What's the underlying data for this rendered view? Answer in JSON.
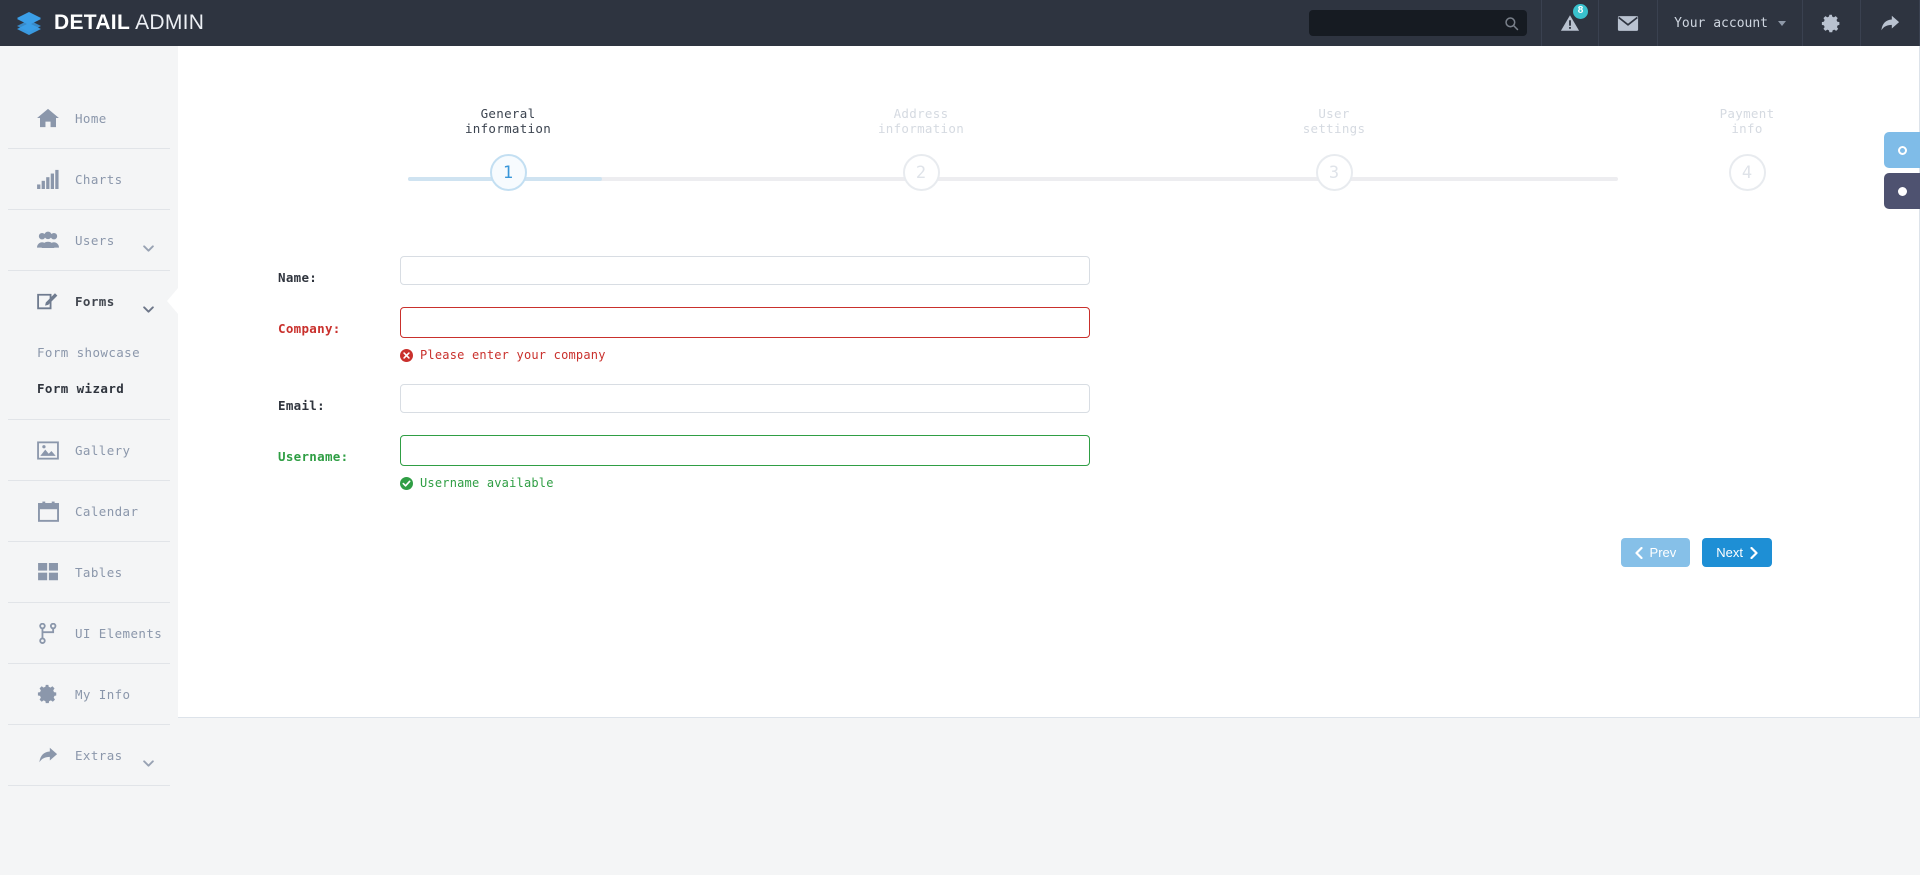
{
  "header": {
    "logo_icon": "layers-icon",
    "brand_bold": "DETAIL",
    "brand_light": "ADMIN",
    "search": {
      "value": "",
      "placeholder": "",
      "icon": "search-icon"
    },
    "alerts": {
      "icon": "warning-triangle-icon",
      "badge": "8"
    },
    "messages": {
      "icon": "envelope-icon"
    },
    "account": {
      "label": "Your account",
      "icon": "chevron-down-icon"
    },
    "settings": {
      "icon": "gear-icon"
    },
    "logout": {
      "icon": "forward-arrow-icon"
    }
  },
  "sidebar": {
    "items": [
      {
        "label": "Home",
        "icon": "home-icon",
        "caret": false,
        "active": false
      },
      {
        "label": "Charts",
        "icon": "bars-icon",
        "caret": false,
        "active": false
      },
      {
        "label": "Users",
        "icon": "users-icon",
        "caret": true,
        "active": false
      },
      {
        "label": "Forms",
        "icon": "pencil-square-icon",
        "caret": true,
        "active": true
      },
      {
        "label": "Gallery",
        "icon": "image-icon",
        "caret": false,
        "active": false
      },
      {
        "label": "Calendar",
        "icon": "calendar-icon",
        "caret": false,
        "active": false
      },
      {
        "label": "Tables",
        "icon": "grid-icon",
        "caret": false,
        "active": false
      },
      {
        "label": "UI Elements",
        "icon": "sitemap-icon",
        "caret": true,
        "active": false
      },
      {
        "label": "My Info",
        "icon": "gear-icon",
        "caret": false,
        "active": false
      },
      {
        "label": "Extras",
        "icon": "forward-arrow-icon",
        "caret": true,
        "active": false
      }
    ],
    "submenu": [
      {
        "label": "Form showcase",
        "active": false
      },
      {
        "label": "Form wizard",
        "active": true
      }
    ]
  },
  "wizard": {
    "steps": [
      {
        "number": "1",
        "title": "General\ninformation",
        "active": true
      },
      {
        "number": "2",
        "title": "Address\ninformation",
        "active": false
      },
      {
        "number": "3",
        "title": "User\nsettings",
        "active": false
      },
      {
        "number": "4",
        "title": "Payment\ninfo",
        "active": false
      }
    ],
    "progress_percent": 16
  },
  "form": {
    "fields": [
      {
        "label": "Name:",
        "value": "",
        "placeholder": "",
        "state": "normal",
        "message": "",
        "message_icon": ""
      },
      {
        "label": "Company:",
        "value": "",
        "placeholder": "",
        "state": "error",
        "message": "Please enter your company",
        "message_icon": "error-circle-icon"
      },
      {
        "label": "Email:",
        "value": "",
        "placeholder": "",
        "state": "normal",
        "message": "",
        "message_icon": ""
      },
      {
        "label": "Username:",
        "value": "",
        "placeholder": "",
        "state": "ok",
        "message": "Username available",
        "message_icon": "check-circle-icon"
      }
    ],
    "buttons": {
      "prev": {
        "label": "Prev",
        "icon": "chevron-left-icon"
      },
      "next": {
        "label": "Next",
        "icon": "chevron-right-icon"
      }
    }
  },
  "float_toggles": [
    {
      "icon": "circle-outline-icon",
      "color": "#7fbce8"
    },
    {
      "icon": "circle-filled-icon",
      "color": "#4e5270"
    }
  ]
}
